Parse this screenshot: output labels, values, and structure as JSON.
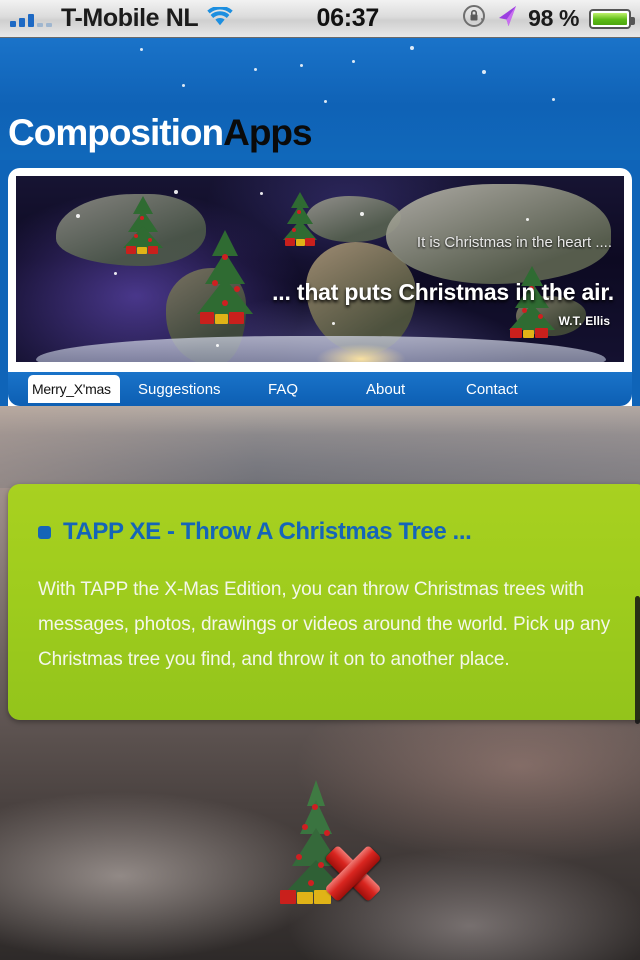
{
  "statusbar": {
    "carrier": "T-Mobile NL",
    "time": "06:37",
    "battery_pct": "98 %",
    "signal_icon": "signal-bars-icon",
    "wifi_icon": "wifi-icon",
    "rotation_lock_icon": "rotation-lock-icon",
    "location_icon": "location-arrow-icon",
    "battery_icon": "battery-icon"
  },
  "header": {
    "brand_white": "Composition",
    "brand_black": "Apps"
  },
  "banner": {
    "quote_line1": "It is Christmas in the heart ....",
    "quote_line2": "... that puts Christmas in the air.",
    "attribution": "W.T. Ellis",
    "image_name": "world-map-christmas-trees"
  },
  "nav": {
    "tabs": [
      {
        "label": "Merry_X'mas",
        "active": true
      },
      {
        "label": "Suggestions",
        "active": false
      },
      {
        "label": "FAQ",
        "active": false
      },
      {
        "label": "About",
        "active": false
      },
      {
        "label": "Contact",
        "active": false
      }
    ]
  },
  "content": {
    "card_title": "TAPP XE - Throw A Christmas Tree ...",
    "card_body": "With TAPP the X-Mas Edition, you can throw Christmas trees with messages, photos, drawings or videos around the world. Pick up any Christmas tree you find, and throw it on to another place."
  },
  "bottom": {
    "tree_icon": "christmas-tree-icon",
    "delete_icon": "red-x-delete-icon"
  },
  "colors": {
    "header_blue": "#1068ba",
    "card_green": "#9ecc1d",
    "title_blue": "#1565b8",
    "delete_red": "#d9251f",
    "battery_green": "#5cbb15"
  }
}
